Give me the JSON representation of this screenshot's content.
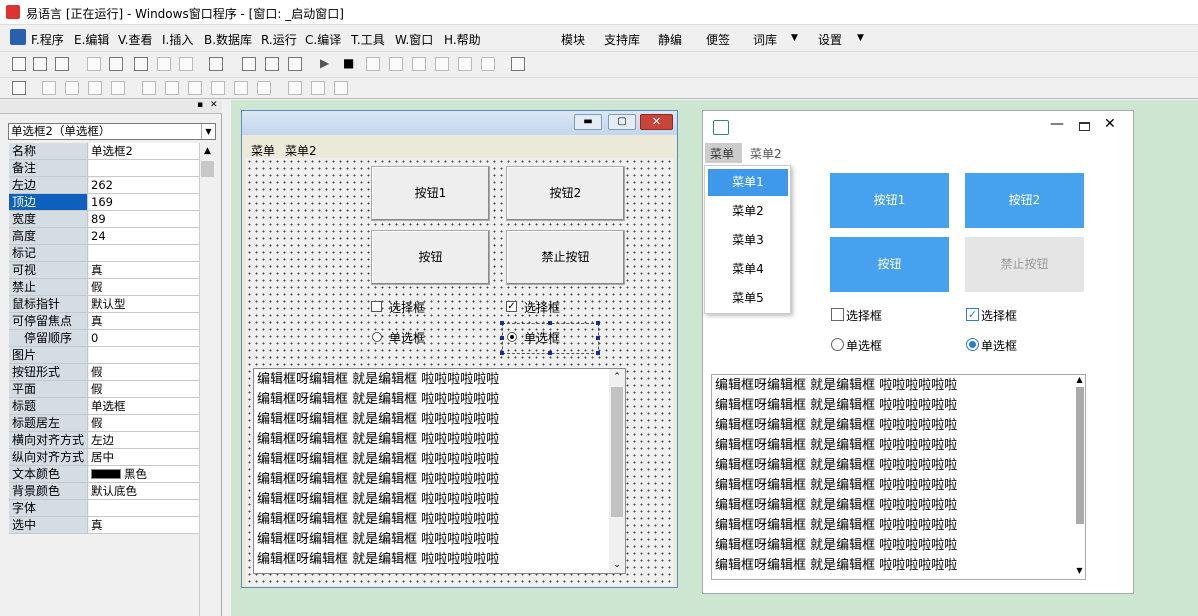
{
  "window": {
    "title": "易语言 [正在运行] - Windows窗口程序 - [窗口: _启动窗口]"
  },
  "menubar": {
    "items": [
      "F.程序",
      "E.编辑",
      "V.查看",
      "I.插入",
      "B.数据库",
      "R.运行",
      "C.编译",
      "T.工具",
      "W.窗口",
      "H.帮助"
    ],
    "right": [
      "模块",
      "支持库",
      "静编",
      "便签",
      "词库",
      "设置"
    ]
  },
  "properties": {
    "combo": "单选框2（单选框）",
    "rows": [
      [
        "名称",
        "单选框2"
      ],
      [
        "备注",
        ""
      ],
      [
        "左边",
        "262"
      ],
      [
        "顶边",
        "169"
      ],
      [
        "宽度",
        "89"
      ],
      [
        "高度",
        "24"
      ],
      [
        "标记",
        ""
      ],
      [
        "可视",
        "真"
      ],
      [
        "禁止",
        "假"
      ],
      [
        "鼠标指针",
        "默认型"
      ],
      [
        "可停留焦点",
        "真"
      ],
      [
        "停留顺序",
        "0"
      ],
      [
        "图片",
        ""
      ],
      [
        "按钮形式",
        "假"
      ],
      [
        "平面",
        "假"
      ],
      [
        "标题",
        "单选框"
      ],
      [
        "标题居左",
        "假"
      ],
      [
        "横向对齐方式",
        "左边"
      ],
      [
        "纵向对齐方式",
        "居中"
      ],
      [
        "文本颜色",
        "黑色"
      ],
      [
        "背景颜色",
        "默认底色"
      ],
      [
        "字体",
        ""
      ],
      [
        "选中",
        "真"
      ]
    ],
    "selected_row": 3,
    "text_color_swatch": "#000000"
  },
  "designer": {
    "menu": [
      "菜单",
      "菜单2"
    ],
    "buttons": [
      "按钮1",
      "按钮2",
      "按钮",
      "禁止按钮"
    ],
    "checkboxes": [
      {
        "label": "选择框",
        "checked": false
      },
      {
        "label": "选择框",
        "checked": true
      }
    ],
    "radios": [
      {
        "label": "单选框",
        "checked": false
      },
      {
        "label": "单选框",
        "checked": true
      }
    ]
  },
  "edit": {
    "lines": [
      "编辑框呀编辑框 就是编辑框 啦啦啦啦啦啦",
      "编辑框呀编辑框 就是编辑框 啦啦啦啦啦啦",
      "编辑框呀编辑框 就是编辑框 啦啦啦啦啦啦",
      "编辑框呀编辑框 就是编辑框 啦啦啦啦啦啦",
      "编辑框呀编辑框 就是编辑框 啦啦啦啦啦啦",
      "编辑框呀编辑框 就是编辑框 啦啦啦啦啦啦",
      "编辑框呀编辑框 就是编辑框 啦啦啦啦啦啦",
      "编辑框呀编辑框 就是编辑框 啦啦啦啦啦啦",
      "编辑框呀编辑框 就是编辑框 啦啦啦啦啦啦",
      "编辑框呀编辑框 就是编辑框 啦啦啦啦啦啦"
    ]
  },
  "runtime": {
    "menu": [
      "菜单",
      "菜单2"
    ],
    "dropdown": [
      "菜单1",
      "菜单2",
      "菜单3",
      "菜单4",
      "菜单5"
    ],
    "buttons": [
      "按钮1",
      "按钮2",
      "按钮",
      "禁止按钮"
    ],
    "checkboxes": [
      {
        "label": "选择框",
        "checked": false
      },
      {
        "label": "选择框",
        "checked": true
      }
    ],
    "radios": [
      {
        "label": "单选框",
        "checked": false
      },
      {
        "label": "单选框",
        "checked": true
      }
    ],
    "accent": "#46a1ef"
  }
}
